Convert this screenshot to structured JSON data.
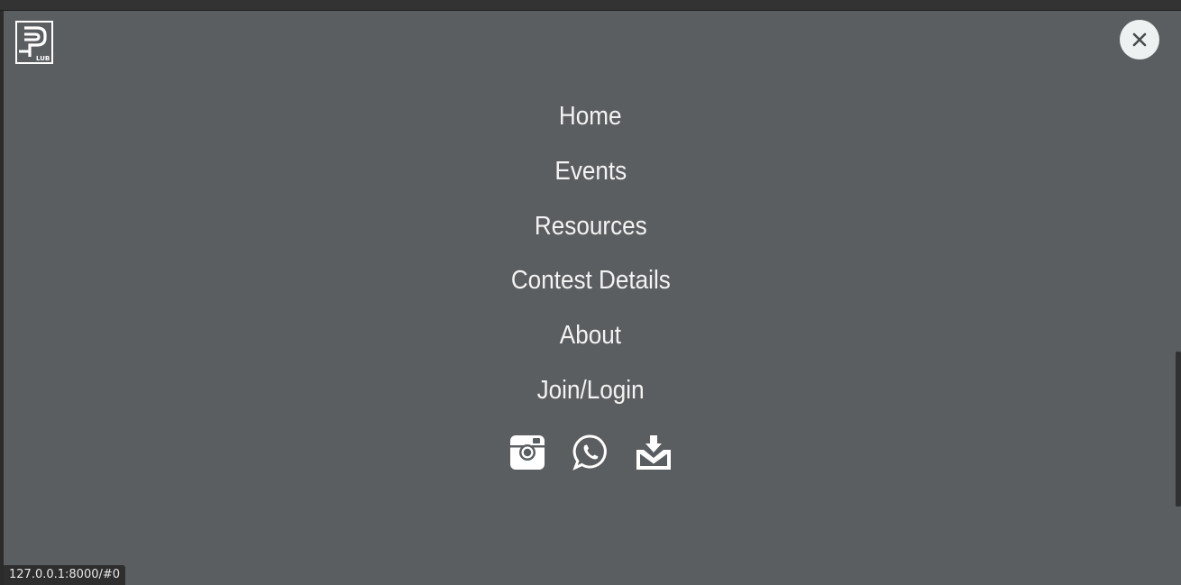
{
  "menu": {
    "items": [
      {
        "label": "Home"
      },
      {
        "label": "Events"
      },
      {
        "label": "Resources"
      },
      {
        "label": "Contest Details"
      },
      {
        "label": "About"
      },
      {
        "label": "Join/Login"
      }
    ]
  },
  "social": {
    "icons": [
      "instagram-icon",
      "whatsapp-icon",
      "mail-download-icon"
    ]
  },
  "status_bar": {
    "url": "127.0.0.1:8000/#0"
  },
  "colors": {
    "overlay_bg": "#5b5e61",
    "text": "#f3f3f3",
    "close_button_bg": "#eef1f1"
  },
  "logo": {
    "text": "LUB"
  }
}
